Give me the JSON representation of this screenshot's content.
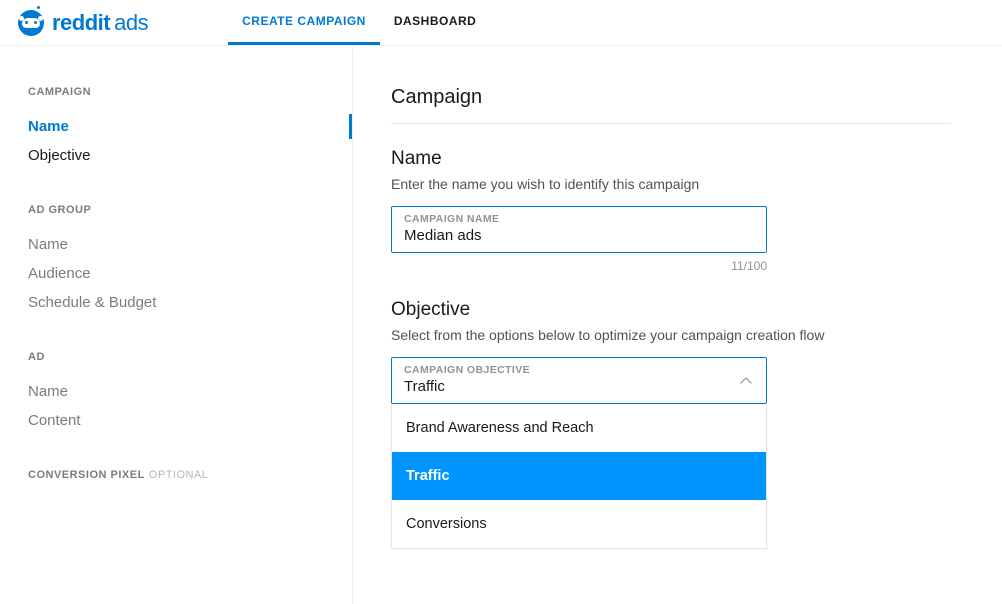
{
  "brand": {
    "text": "reddit",
    "suffix": "ads"
  },
  "topnav": {
    "items": [
      {
        "label": "CREATE CAMPAIGN",
        "active": true
      },
      {
        "label": "DASHBOARD",
        "active": false
      }
    ]
  },
  "sidebar": {
    "groups": [
      {
        "heading": "CAMPAIGN",
        "items": [
          {
            "label": "Name",
            "active": true,
            "enabled": true
          },
          {
            "label": "Objective",
            "active": false,
            "enabled": true
          }
        ]
      },
      {
        "heading": "AD GROUP",
        "items": [
          {
            "label": "Name",
            "enabled": false
          },
          {
            "label": "Audience",
            "enabled": false
          },
          {
            "label": "Schedule & Budget",
            "enabled": false
          }
        ]
      },
      {
        "heading": "AD",
        "items": [
          {
            "label": "Name",
            "enabled": false
          },
          {
            "label": "Content",
            "enabled": false
          }
        ]
      }
    ],
    "conversion_pixel": {
      "label": "CONVERSION PIXEL",
      "badge": "OPTIONAL"
    }
  },
  "main": {
    "page_title": "Campaign",
    "name_section": {
      "title": "Name",
      "desc": "Enter the name you wish to identify this campaign",
      "field_label": "CAMPAIGN NAME",
      "value": "Median ads",
      "counter": "11/100"
    },
    "objective_section": {
      "title": "Objective",
      "desc": "Select from the options below to optimize your campaign creation flow",
      "field_label": "CAMPAIGN OBJECTIVE",
      "value": "Traffic",
      "options": [
        {
          "label": "Brand Awareness and Reach",
          "active": false
        },
        {
          "label": "Traffic",
          "active": true
        },
        {
          "label": "Conversions",
          "active": false
        }
      ]
    }
  }
}
